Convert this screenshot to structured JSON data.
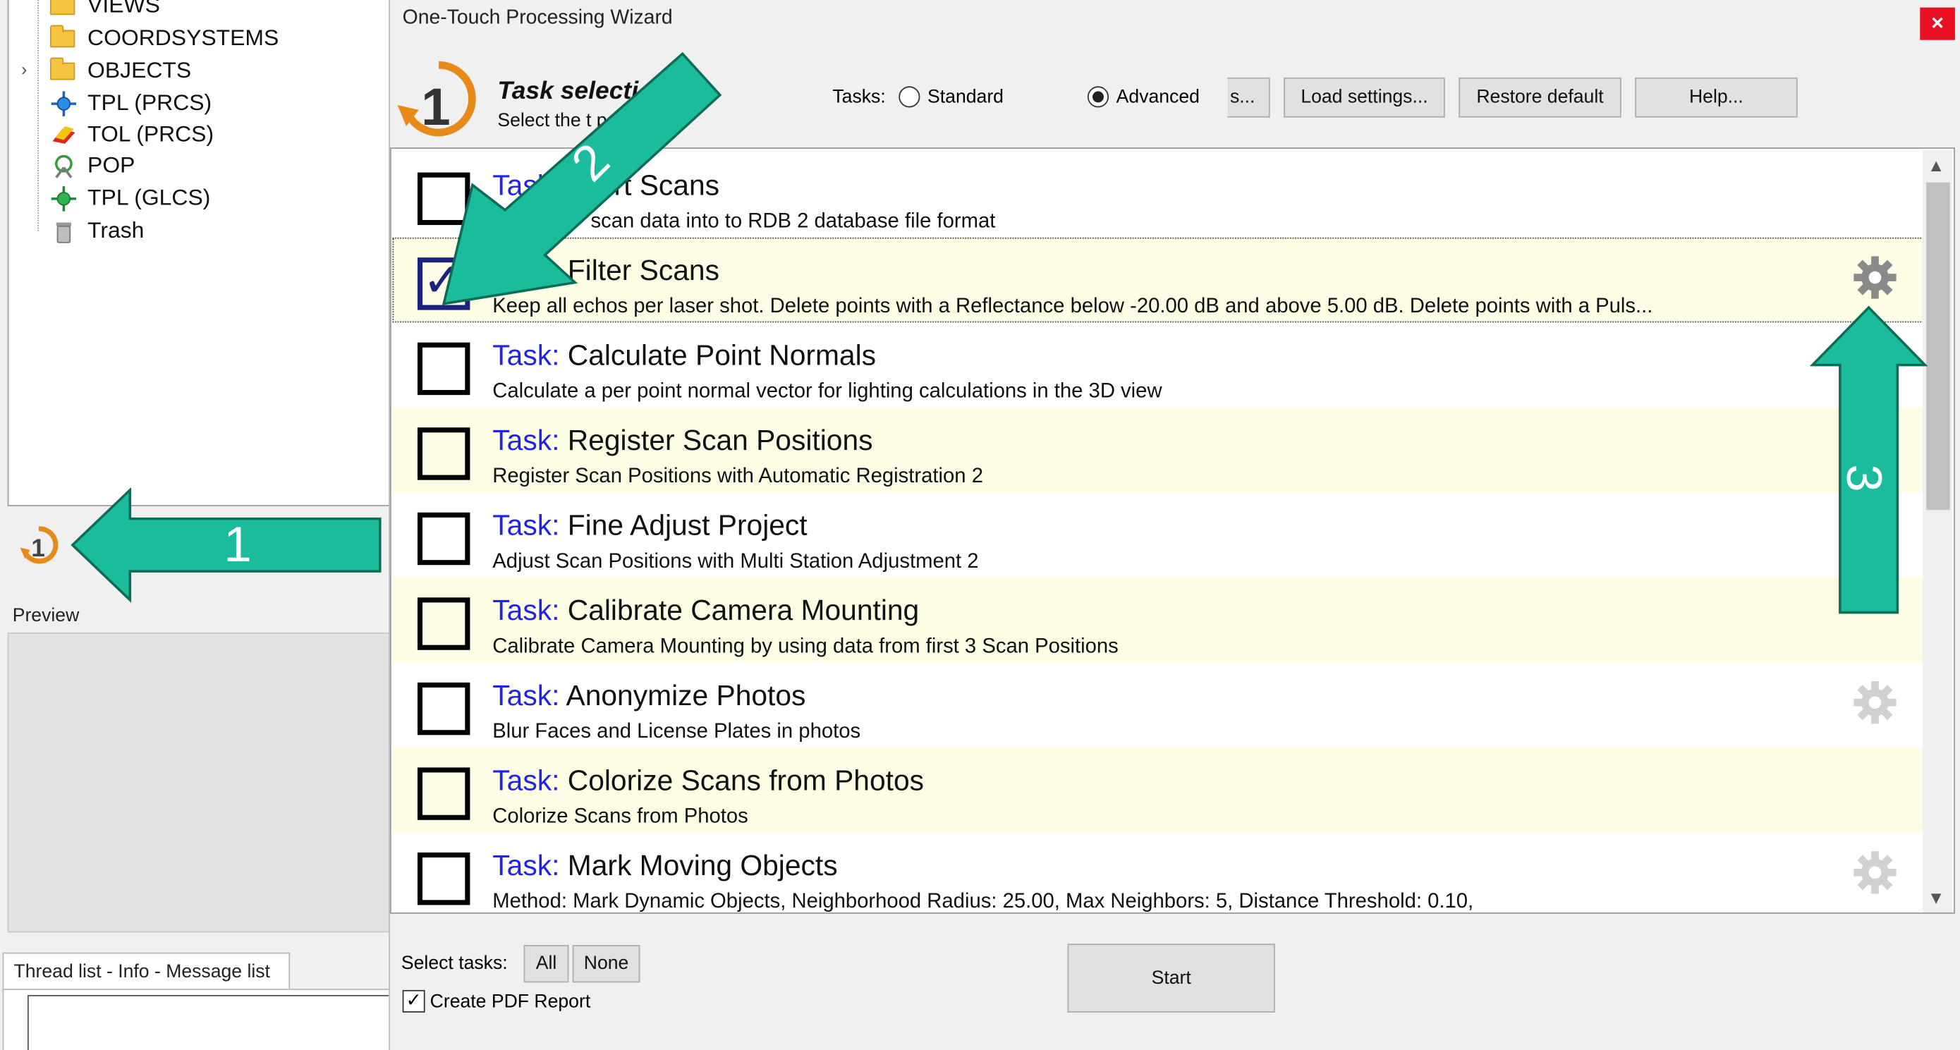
{
  "tree": {
    "items": [
      {
        "label": "VIEWS",
        "icon": "folder-icon"
      },
      {
        "label": "COORDSYSTEMS",
        "icon": "folder-icon"
      },
      {
        "label": "OBJECTS",
        "icon": "folder-icon"
      },
      {
        "label": "TPL (PRCS)",
        "icon": "tiepoint-list-icon"
      },
      {
        "label": "TOL (PRCS)",
        "icon": "tieobject-list-icon"
      },
      {
        "label": "POP",
        "icon": "pop-icon"
      },
      {
        "label": "TPL (GLCS)",
        "icon": "tiepoint-list-icon"
      },
      {
        "label": "Trash",
        "icon": "trash-icon"
      }
    ]
  },
  "left": {
    "preview_title": "Preview",
    "thread_tab": "Thread list - Info - Message list"
  },
  "dialog": {
    "title": "One-Touch Processing Wizard",
    "close": "×",
    "header_title": "Task selecti",
    "header_subtitle": "Select the t        performed",
    "tasks_label": "Tasks:",
    "radio_standard": "Standard",
    "radio_advanced": "Advanced",
    "btn_save_partial": "s...",
    "btn_load": "Load settings...",
    "btn_restore": "Restore default",
    "btn_help": "Help...",
    "task_prefix": "Task:",
    "tasks": [
      {
        "title": "Convert Scans",
        "title_visible": "nvert Scans",
        "desc": "t raw RXP scan data into to RDB 2 database file format",
        "checked": false,
        "gear": "none"
      },
      {
        "title": "Filter Scans",
        "desc": "Keep all echos per laser shot. Delete points with a Reflectance below -20.00 dB and above 5.00 dB. Delete points with a Puls...",
        "checked": true,
        "gear": "active"
      },
      {
        "title": "Calculate Point Normals",
        "desc": "Calculate a per point normal vector for lighting calculations in the 3D view",
        "checked": false,
        "gear": "none"
      },
      {
        "title": "Register Scan Positions",
        "desc": "Register Scan Positions with Automatic Registration 2",
        "checked": false,
        "gear": "none"
      },
      {
        "title": "Fine Adjust Project",
        "desc": "Adjust Scan Positions with Multi Station Adjustment 2",
        "checked": false,
        "gear": "none"
      },
      {
        "title": "Calibrate Camera Mounting",
        "desc": "Calibrate Camera Mounting by using data from first 3 Scan Positions",
        "checked": false,
        "gear": "none"
      },
      {
        "title": "Anonymize Photos",
        "desc": "Blur Faces and License Plates in photos",
        "checked": false,
        "gear": "dim"
      },
      {
        "title": "Colorize Scans from Photos",
        "desc": "Colorize Scans from Photos",
        "checked": false,
        "gear": "none"
      },
      {
        "title": "Mark Moving Objects",
        "desc": "Method: Mark Dynamic Objects, Neighborhood Radius: 25.00, Max Neighbors:       5, Distance Threshold:  0.10,",
        "checked": false,
        "gear": "dim"
      }
    ],
    "select_tasks_label": "Select tasks:",
    "btn_all": "All",
    "btn_none": "None",
    "btn_start": "Start",
    "pdf_label": "Create PDF Report",
    "pdf_checked": true
  },
  "annotations": {
    "arrow1": "1",
    "arrow2": "2",
    "arrow3": "3",
    "color": "#1abc9c"
  },
  "colors": {
    "task_prefix": "#2323e6",
    "row_alt": "#fdfde6",
    "close_red": "#e81123",
    "checkbox_checked": "#1a237e"
  }
}
